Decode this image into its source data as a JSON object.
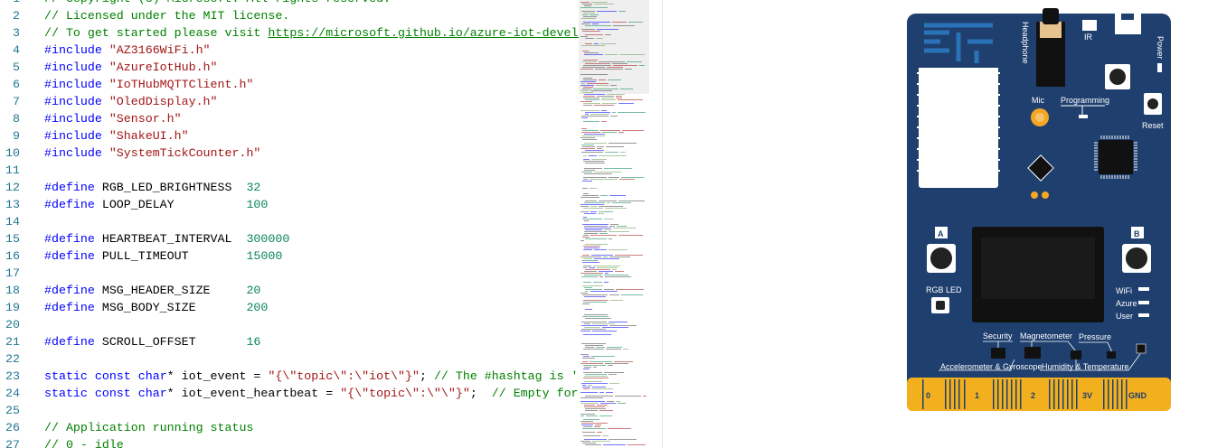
{
  "editor": {
    "lines": [
      {
        "n": "1",
        "tokens": [
          {
            "t": "// Copyright (c) Microsoft. All rights reserved.",
            "c": "c-comment"
          }
        ]
      },
      {
        "n": "2",
        "tokens": [
          {
            "t": "// Licensed under the MIT license.",
            "c": "c-comment"
          }
        ]
      },
      {
        "n": "3",
        "tokens": [
          {
            "t": "// To get started please visit ",
            "c": "c-comment"
          },
          {
            "t": "https://microsoft.github.io/azure-iot-developer-kit",
            "c": "c-link"
          }
        ]
      },
      {
        "n": "4",
        "tokens": [
          {
            "t": "#include ",
            "c": "c-kw"
          },
          {
            "t": "\"AZ3166WiFi.h\"",
            "c": "c-str"
          }
        ]
      },
      {
        "n": "5",
        "tokens": [
          {
            "t": "#include ",
            "c": "c-kw"
          },
          {
            "t": "\"AzureIotHub.h\"",
            "c": "c-str"
          }
        ]
      },
      {
        "n": "6",
        "tokens": [
          {
            "t": "#include ",
            "c": "c-kw"
          },
          {
            "t": "\"IoTHubMQTTClient.h\"",
            "c": "c-str"
          }
        ]
      },
      {
        "n": "7",
        "tokens": [
          {
            "t": "#include ",
            "c": "c-kw"
          },
          {
            "t": "\"OledDisplay.h\"",
            "c": "c-str"
          }
        ]
      },
      {
        "n": "8",
        "tokens": [
          {
            "t": "#include ",
            "c": "c-kw"
          },
          {
            "t": "\"Sensor.h\"",
            "c": "c-str"
          }
        ]
      },
      {
        "n": "9",
        "tokens": [
          {
            "t": "#include ",
            "c": "c-kw"
          },
          {
            "t": "\"ShakeUI.h\"",
            "c": "c-str"
          }
        ]
      },
      {
        "n": "10",
        "tokens": [
          {
            "t": "#include ",
            "c": "c-kw"
          },
          {
            "t": "\"SystemTickCounter.h\"",
            "c": "c-str"
          }
        ]
      },
      {
        "n": "11",
        "tokens": []
      },
      {
        "n": "12",
        "tokens": [
          {
            "t": "#define ",
            "c": "c-kw"
          },
          {
            "t": "RGB_LED_BRIGHTNESS  ",
            "c": "c-plain"
          },
          {
            "t": "32",
            "c": "c-num"
          }
        ]
      },
      {
        "n": "13",
        "tokens": [
          {
            "t": "#define ",
            "c": "c-kw"
          },
          {
            "t": "LOOP_DELAY          ",
            "c": "c-plain"
          },
          {
            "t": "100",
            "c": "c-num"
          }
        ]
      },
      {
        "n": "14",
        "tokens": []
      },
      {
        "n": "15",
        "tokens": [
          {
            "t": "#define ",
            "c": "c-kw"
          },
          {
            "t": "HEARTBEAT_INTERVAL  ",
            "c": "c-plain"
          },
          {
            "t": "300000",
            "c": "c-num"
          }
        ]
      },
      {
        "n": "16",
        "tokens": [
          {
            "t": "#define ",
            "c": "c-kw"
          },
          {
            "t": "PULL_TIMEOUT        ",
            "c": "c-plain"
          },
          {
            "t": "15000",
            "c": "c-num"
          }
        ]
      },
      {
        "n": "17",
        "tokens": []
      },
      {
        "n": "18",
        "tokens": [
          {
            "t": "#define ",
            "c": "c-kw"
          },
          {
            "t": "MSG_HEADER_SIZE     ",
            "c": "c-plain"
          },
          {
            "t": "20",
            "c": "c-num"
          }
        ]
      },
      {
        "n": "19",
        "tokens": [
          {
            "t": "#define ",
            "c": "c-kw"
          },
          {
            "t": "MSG_BODY_SIZE       ",
            "c": "c-plain"
          },
          {
            "t": "200",
            "c": "c-num"
          }
        ]
      },
      {
        "n": "20",
        "tokens": []
      },
      {
        "n": "21",
        "tokens": [
          {
            "t": "#define ",
            "c": "c-kw"
          },
          {
            "t": "SCROLL_OFFSET       ",
            "c": "c-plain"
          },
          {
            "t": "16",
            "c": "c-num"
          }
        ]
      },
      {
        "n": "22",
        "tokens": []
      },
      {
        "n": "23",
        "tokens": [
          {
            "t": "static ",
            "c": "c-kw"
          },
          {
            "t": "const ",
            "c": "c-kw"
          },
          {
            "t": "char",
            "c": "c-kw"
          },
          {
            "t": "* iot_event = ",
            "c": "c-plain"
          },
          {
            "t": "\"{\\\"topic\\\":\\\"iot\\\"}\"",
            "c": "c-str"
          },
          {
            "t": "; ",
            "c": "c-plain"
          },
          {
            "t": "// The #hashtag is 'iot'",
            "c": "c-comment"
          }
        ]
      },
      {
        "n": "24",
        "tokens": [
          {
            "t": "static ",
            "c": "c-kw"
          },
          {
            "t": "const ",
            "c": "c-kw"
          },
          {
            "t": "char",
            "c": "c-kw"
          },
          {
            "t": "* iot_event_heartbeat = ",
            "c": "c-plain"
          },
          {
            "t": "\"{\\\"topic\\\":\\\"\\\"}\"",
            "c": "c-str"
          },
          {
            "t": ";  ",
            "c": "c-plain"
          },
          {
            "t": "// Empty for heartbeat",
            "c": "c-comment"
          }
        ]
      },
      {
        "n": "25",
        "tokens": []
      },
      {
        "n": "26",
        "tokens": [
          {
            "t": "// Application running status",
            "c": "c-comment"
          }
        ]
      },
      {
        "n": "27",
        "tokens": [
          {
            "t": "// 0 - idle",
            "c": "c-comment"
          }
        ]
      }
    ]
  },
  "board": {
    "labels": {
      "headphone": "Headphone",
      "ir": "IR",
      "power": "Power",
      "mic": "Mic",
      "programming": "Programming",
      "reset": "Reset",
      "button_a": "A",
      "button_b": "B",
      "rgb_led": "RGB LED",
      "wifi": "WiFi",
      "azure": "Azure",
      "user": "User",
      "security": "Security",
      "magnetometer": "Magnetometer",
      "pressure": "Pressure",
      "accel_gyro": "Accelerometer & Gyroscope",
      "humidity_temp": "Humidity & Temperature",
      "pin_0": "0",
      "pin_1": "1",
      "pin_2": "2",
      "pin_3v": "3V",
      "pin_gnd": "GND"
    },
    "colors": {
      "board": "#1f3f6e",
      "edge_connector": "#f2b01e",
      "module": "#ffffff",
      "mic": "#f5a623"
    }
  }
}
